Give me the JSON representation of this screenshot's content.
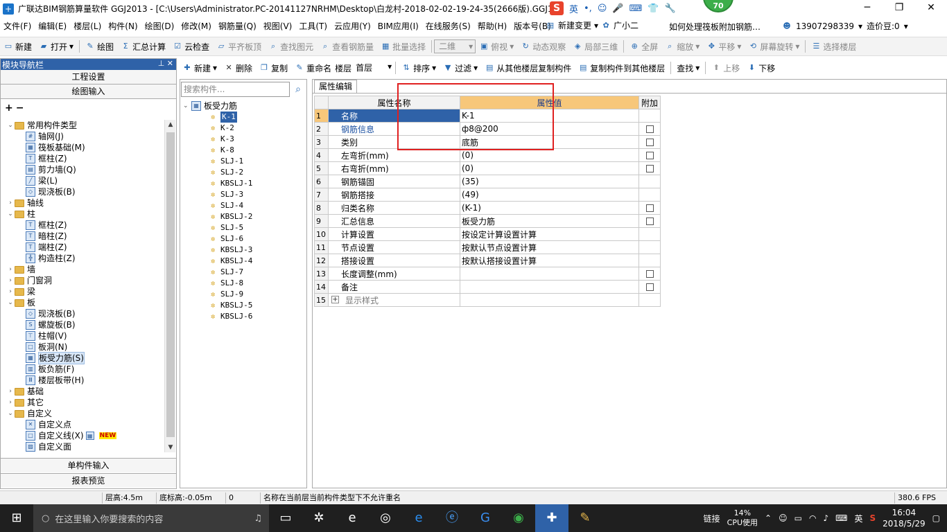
{
  "window": {
    "title": "广联达BIM钢筋算量软件 GGJ2013 - [C:\\Users\\Administrator.PC-20141127NRHM\\Desktop\\白龙村-2018-02-02-19-24-35(2666版).GGJ12]",
    "score": "70",
    "ime_items": [
      "英",
      "•,",
      "☺",
      "🎤",
      "⌨",
      "👕",
      "🔧"
    ]
  },
  "menu": {
    "items": [
      "文件(F)",
      "编辑(E)",
      "楼层(L)",
      "构件(N)",
      "绘图(D)",
      "修改(M)",
      "钢筋量(Q)",
      "视图(V)",
      "工具(T)",
      "云应用(Y)",
      "BIM应用(I)",
      "在线服务(S)",
      "帮助(H)",
      "版本号(B)"
    ],
    "new_change": "新建变更",
    "assistant": "广小二",
    "hint": "如何处理筏板附加钢筋…",
    "phone": "13907298339",
    "price": "造价豆:0"
  },
  "toolbar1": {
    "new": "新建",
    "open": "打开",
    "draw": "绘图",
    "sum": "汇总计算",
    "cloud_check": "云检查",
    "flat_top": "平齐板顶",
    "find_elem": "查找图元",
    "view_rebar": "查看钢筋量",
    "batch_select": "批量选择",
    "view_mode": "二维",
    "top_view": "俯视",
    "dynamic": "动态观察",
    "local3d": "局部三维",
    "fullscreen": "全屏",
    "zoom": "缩放",
    "pan": "平移",
    "rotate": "屏幕旋转",
    "select_floor": "选择楼层"
  },
  "nav": {
    "header": "模块导航栏",
    "pin": "⊥ ✕",
    "project_settings": "工程设置",
    "draw_input": "绘图输入",
    "tree": [
      {
        "level": 0,
        "exp": "⌄",
        "type": "folder",
        "label": "常用构件类型"
      },
      {
        "level": 1,
        "type": "leaf",
        "icon": "#",
        "label": "轴网(J)"
      },
      {
        "level": 1,
        "type": "leaf",
        "icon": "▦",
        "label": "筏板基础(M)"
      },
      {
        "level": 1,
        "type": "leaf",
        "icon": "T",
        "label": "框柱(Z)"
      },
      {
        "level": 1,
        "type": "leaf",
        "icon": "▤",
        "label": "剪力墙(Q)"
      },
      {
        "level": 1,
        "type": "leaf",
        "icon": "╱",
        "label": "梁(L)"
      },
      {
        "level": 1,
        "type": "leaf",
        "icon": "◇",
        "label": "现浇板(B)"
      },
      {
        "level": 0,
        "exp": "›",
        "type": "folder",
        "label": "轴线"
      },
      {
        "level": 0,
        "exp": "⌄",
        "type": "folder",
        "label": "柱"
      },
      {
        "level": 1,
        "type": "leaf",
        "icon": "T",
        "label": "框柱(Z)"
      },
      {
        "level": 1,
        "type": "leaf",
        "icon": "T",
        "label": "暗柱(Z)"
      },
      {
        "level": 1,
        "type": "leaf",
        "icon": "T",
        "label": "端柱(Z)"
      },
      {
        "level": 1,
        "type": "leaf",
        "icon": "╬",
        "label": "构造柱(Z)"
      },
      {
        "level": 0,
        "exp": "›",
        "type": "folder",
        "label": "墙"
      },
      {
        "level": 0,
        "exp": "›",
        "type": "folder",
        "label": "门窗洞"
      },
      {
        "level": 0,
        "exp": "›",
        "type": "folder",
        "label": "梁"
      },
      {
        "level": 0,
        "exp": "⌄",
        "type": "folder",
        "label": "板"
      },
      {
        "level": 1,
        "type": "leaf",
        "icon": "◇",
        "label": "现浇板(B)"
      },
      {
        "level": 1,
        "type": "leaf",
        "icon": "S",
        "label": "螺旋板(B)"
      },
      {
        "level": 1,
        "type": "leaf",
        "icon": "⊤",
        "label": "柱帽(V)"
      },
      {
        "level": 1,
        "type": "leaf",
        "icon": "□",
        "label": "板洞(N)"
      },
      {
        "level": 1,
        "type": "leaf",
        "icon": "▦",
        "label": "板受力筋(S)",
        "selected": true
      },
      {
        "level": 1,
        "type": "leaf",
        "icon": "▥",
        "label": "板负筋(F)"
      },
      {
        "level": 1,
        "type": "leaf",
        "icon": "Ⅲ",
        "label": "楼层板带(H)"
      },
      {
        "level": 0,
        "exp": "›",
        "type": "folder",
        "label": "基础"
      },
      {
        "level": 0,
        "exp": "›",
        "type": "folder",
        "label": "其它"
      },
      {
        "level": 0,
        "exp": "⌄",
        "type": "folder",
        "label": "自定义"
      },
      {
        "level": 1,
        "type": "leaf",
        "icon": "✕",
        "label": "自定义点"
      },
      {
        "level": 1,
        "type": "leaf",
        "icon": "□",
        "label": "自定义线(X)",
        "badge": "NEW"
      },
      {
        "level": 1,
        "type": "leaf",
        "icon": "▨",
        "label": "自定义面"
      }
    ],
    "single_input": "单构件输入",
    "report": "报表预览"
  },
  "toolbar2": {
    "new": "新建",
    "delete": "删除",
    "copy": "复制",
    "rename": "重命名",
    "floor_label": "楼层",
    "floor_value": "首层",
    "sort": "排序",
    "filter": "过滤",
    "copy_from": "从其他楼层复制构件",
    "copy_to": "复制构件到其他楼层",
    "find": "查找",
    "up": "上移",
    "down": "下移"
  },
  "components": {
    "search_placeholder": "搜索构件...",
    "root": "板受力筋",
    "items": [
      "K-1",
      "K-2",
      "K-3",
      "K-8",
      "SLJ-1",
      "SLJ-2",
      "KBSLJ-1",
      "SLJ-3",
      "SLJ-4",
      "KBSLJ-2",
      "SLJ-5",
      "SLJ-6",
      "KBSLJ-3",
      "KBSLJ-4",
      "SLJ-7",
      "SLJ-8",
      "SLJ-9",
      "KBSLJ-5",
      "KBSLJ-6"
    ],
    "selected": "K-1"
  },
  "props": {
    "tab": "属性编辑",
    "col_name": "属性名称",
    "col_value": "属性值",
    "col_add": "附加",
    "rows": [
      {
        "n": "1",
        "name": "名称",
        "value": "K-1",
        "chk": false,
        "selected": true
      },
      {
        "n": "2",
        "name": "钢筋信息",
        "value": "ф8@200",
        "chk": true,
        "link": true
      },
      {
        "n": "3",
        "name": "类别",
        "value": "底筋",
        "chk": true
      },
      {
        "n": "4",
        "name": "左弯折(mm)",
        "value": "(0)",
        "chk": true
      },
      {
        "n": "5",
        "name": "右弯折(mm)",
        "value": "(0)",
        "chk": true
      },
      {
        "n": "6",
        "name": "钢筋锚固",
        "value": "(35)",
        "chk": false
      },
      {
        "n": "7",
        "name": "钢筋搭接",
        "value": "(49)",
        "chk": false
      },
      {
        "n": "8",
        "name": "归类名称",
        "value": "(K-1)",
        "chk": true
      },
      {
        "n": "9",
        "name": "汇总信息",
        "value": "板受力筋",
        "chk": true
      },
      {
        "n": "10",
        "name": "计算设置",
        "value": "按设定计算设置计算",
        "chk": false
      },
      {
        "n": "11",
        "name": "节点设置",
        "value": "按默认节点设置计算",
        "chk": false
      },
      {
        "n": "12",
        "name": "搭接设置",
        "value": "按默认搭接设置计算",
        "chk": false
      },
      {
        "n": "13",
        "name": "长度调整(mm)",
        "value": "",
        "chk": true
      },
      {
        "n": "14",
        "name": "备注",
        "value": "",
        "chk": true
      },
      {
        "n": "15",
        "name": "显示样式",
        "value": "",
        "chk": false,
        "muted": true,
        "plus": true
      }
    ]
  },
  "status": {
    "floor_height": "层高:4.5m",
    "bottom_height": "底标高:-0.05m",
    "zero": "0",
    "message": "名称在当前层当前构件类型下不允许重名",
    "fps": "380.6 FPS"
  },
  "taskbar": {
    "search_placeholder": "在这里输入你要搜索的内容",
    "link": "链接",
    "cpu_pct": "14%",
    "cpu_label": "CPU使用",
    "lang": "英",
    "time": "16:04",
    "date": "2018/5/29"
  }
}
